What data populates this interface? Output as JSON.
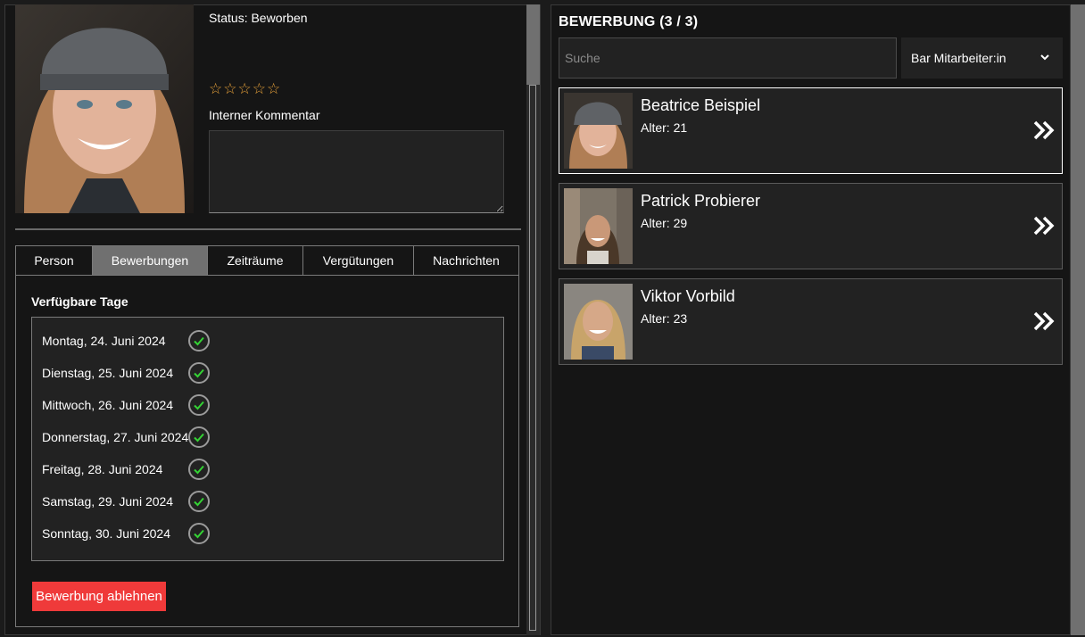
{
  "detail": {
    "status": "Status: Beworben",
    "rating": 0,
    "comment_label": "Interner Kommentar",
    "comment_value": ""
  },
  "tabs": [
    {
      "label": "Person",
      "active": false
    },
    {
      "label": "Bewerbungen",
      "active": true
    },
    {
      "label": "Zeiträume",
      "active": false
    },
    {
      "label": "Vergütungen",
      "active": false
    },
    {
      "label": "Nachrichten",
      "active": false
    }
  ],
  "days": {
    "title": "Verfügbare Tage",
    "items": [
      {
        "label": "Montag, 24. Juni 2024",
        "available": true
      },
      {
        "label": "Dienstag, 25. Juni 2024",
        "available": true
      },
      {
        "label": "Mittwoch, 26. Juni 2024",
        "available": true
      },
      {
        "label": "Donnerstag, 27. Juni 2024",
        "available": true
      },
      {
        "label": "Freitag, 28. Juni 2024",
        "available": true
      },
      {
        "label": "Samstag, 29. Juni 2024",
        "available": true
      },
      {
        "label": "Sonntag, 30. Juni 2024",
        "available": true
      }
    ]
  },
  "actions": {
    "reject_label": "Bewerbung ablehnen"
  },
  "list": {
    "title": "BEWERBUNG (3 / 3)",
    "search_placeholder": "Suche",
    "filter_value": "Bar Mitarbeiter:in",
    "applicants": [
      {
        "name": "Beatrice Beispiel",
        "age": "Alter: 21",
        "selected": true
      },
      {
        "name": "Patrick Probierer",
        "age": "Alter: 29",
        "selected": false
      },
      {
        "name": "Viktor Vorbild",
        "age": "Alter: 23",
        "selected": false
      }
    ]
  },
  "colors": {
    "accent_check": "#34d334",
    "star": "#e8a23a",
    "danger": "#ef3a3a",
    "tab_active": "#707070"
  },
  "icons": {
    "star": "star-outline-icon",
    "check": "check-circle-icon",
    "chevron": "chevron-down-icon",
    "arrow": "double-chevron-right-icon"
  }
}
